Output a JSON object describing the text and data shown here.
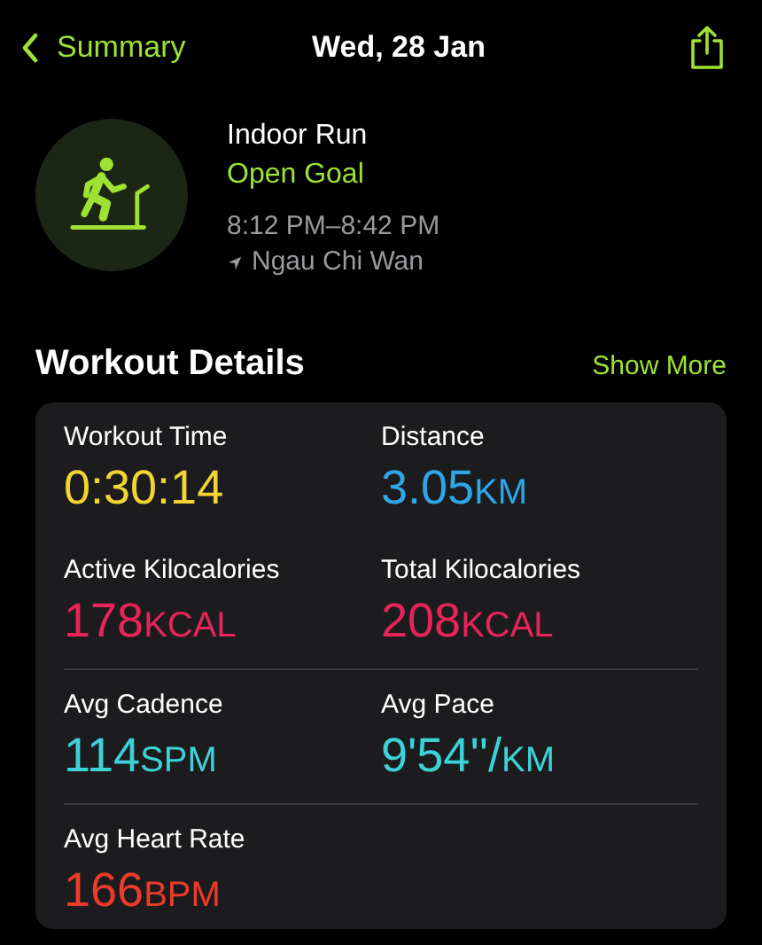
{
  "nav": {
    "back_label": "Summary",
    "title": "Wed, 28 Jan"
  },
  "workout": {
    "name": "Indoor Run",
    "goal": "Open Goal",
    "time_range": "8:12 PM–8:42 PM",
    "location": "Ngau Chi Wan"
  },
  "section": {
    "title": "Workout Details",
    "action": "Show More"
  },
  "metric_rows": [
    {
      "divider": false,
      "metrics": [
        {
          "label": "Workout Time",
          "value": "0:30:14",
          "color": "#f2d531"
        },
        {
          "label": "Distance",
          "value": "3.05",
          "unit": "KM",
          "color": "#2ea6e8"
        }
      ]
    },
    {
      "divider": false,
      "metrics": [
        {
          "label": "Active Kilocalories",
          "value": "178",
          "unit": "KCAL",
          "color": "#e8245a"
        },
        {
          "label": "Total Kilocalories",
          "value": "208",
          "unit": "KCAL",
          "color": "#e8245a"
        }
      ]
    },
    {
      "divider": true,
      "metrics": [
        {
          "label": "Avg Cadence",
          "value": "114",
          "unit": "SPM",
          "color": "#3cd3d8"
        },
        {
          "label": "Avg Pace",
          "value": "9'54''/",
          "unit": "KM",
          "color": "#3cd3d8"
        }
      ]
    },
    {
      "divider": true,
      "metrics": [
        {
          "label": "Avg Heart Rate",
          "value": "166",
          "unit": "BPM",
          "color": "#ec3b2a"
        }
      ]
    }
  ]
}
